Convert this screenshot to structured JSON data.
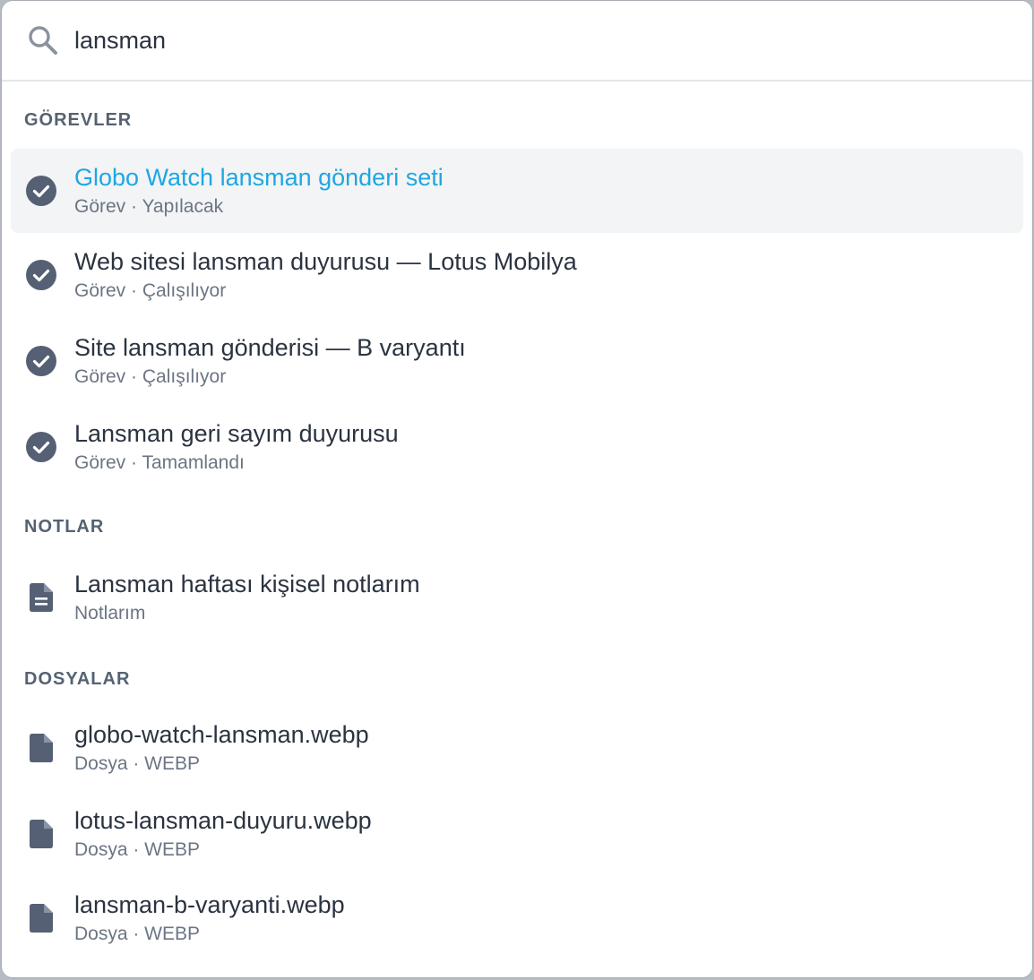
{
  "search": {
    "value": "lansman",
    "icon": "search-icon"
  },
  "colors": {
    "accent": "#1ea7e1",
    "icon": "#566074",
    "header": "#556273",
    "active_bg": "#f3f4f5"
  },
  "sections": {
    "tasks": {
      "header": "GÖREVLER",
      "items": [
        {
          "title": "Globo Watch lansman gönderi seti",
          "subtitle": "Görev · Yapılacak",
          "icon": "check-circle-icon"
        },
        {
          "title": "Web sitesi lansman duyurusu — Lotus Mobilya",
          "subtitle": "Görev · Çalışılıyor",
          "icon": "check-circle-icon"
        },
        {
          "title": "Site lansman gönderisi — B varyantı",
          "subtitle": "Görev · Çalışılıyor",
          "icon": "check-circle-icon"
        },
        {
          "title": "Lansman geri sayım duyurusu",
          "subtitle": "Görev · Tamamlandı",
          "icon": "check-circle-icon"
        }
      ]
    },
    "notes": {
      "header": "NOTLAR",
      "items": [
        {
          "title": "Lansman haftası kişisel notlarım",
          "subtitle": "Notlarım",
          "icon": "note-icon"
        }
      ]
    },
    "files": {
      "header": "DOSYALAR",
      "items": [
        {
          "title": "globo-watch-lansman.webp",
          "subtitle": "Dosya · WEBP",
          "icon": "file-icon"
        },
        {
          "title": "lotus-lansman-duyuru.webp",
          "subtitle": "Dosya · WEBP",
          "icon": "file-icon"
        },
        {
          "title": "lansman-b-varyanti.webp",
          "subtitle": "Dosya · WEBP",
          "icon": "file-icon"
        }
      ]
    }
  }
}
